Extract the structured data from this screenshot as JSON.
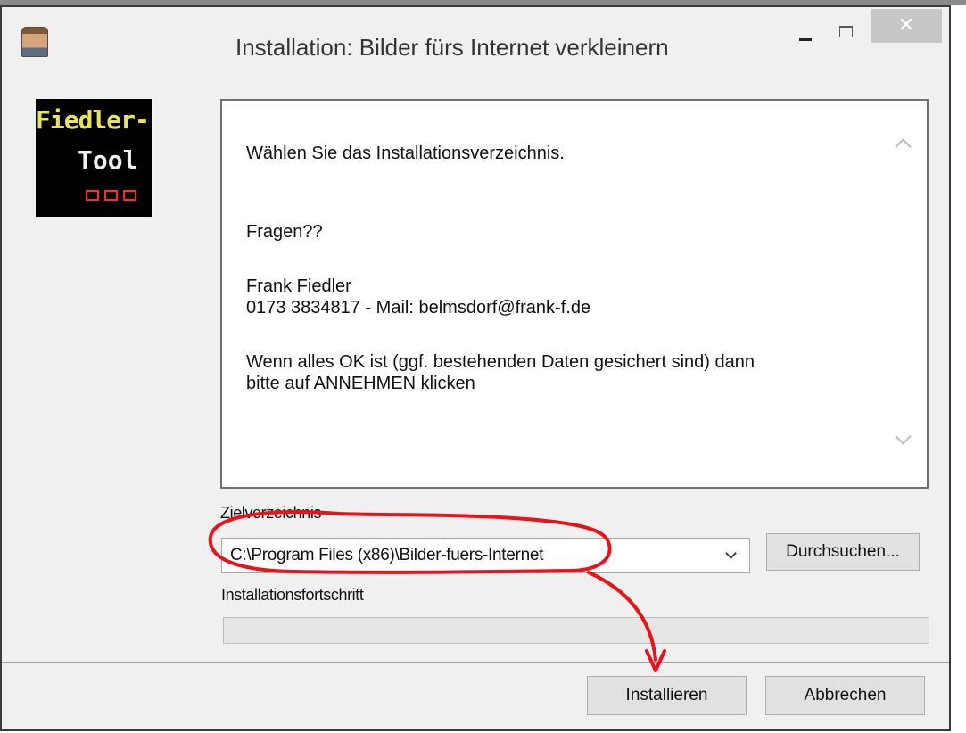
{
  "window": {
    "title": "Installation: Bilder fürs Internet verkleinern",
    "close_glyph": "✕"
  },
  "logo": {
    "line1": "Fiedler-",
    "line2": "Tool"
  },
  "message": {
    "lines": [
      "Wählen Sie das Installationsverzeichnis.",
      "Fragen??",
      "Frank Fiedler",
      "0173 3834817  -  Mail: belmsdorf@frank-f.de",
      "Wenn alles OK ist (ggf. bestehenden Daten gesichert sind) dann",
      "bitte auf ANNEHMEN klicken"
    ]
  },
  "target": {
    "label": "Zielverzeichnis",
    "path": "C:\\Program Files (x86)\\Bilder-fuers-Internet",
    "browse_label": "Durchsuchen..."
  },
  "progress": {
    "label": "Installationsfortschritt",
    "value": 0
  },
  "buttons": {
    "install": "Installieren",
    "cancel": "Abbrechen"
  },
  "colors": {
    "annotation": "#e8141b",
    "logo_yellow": "#e8e35a",
    "logo_red": "#ff2b2b"
  }
}
